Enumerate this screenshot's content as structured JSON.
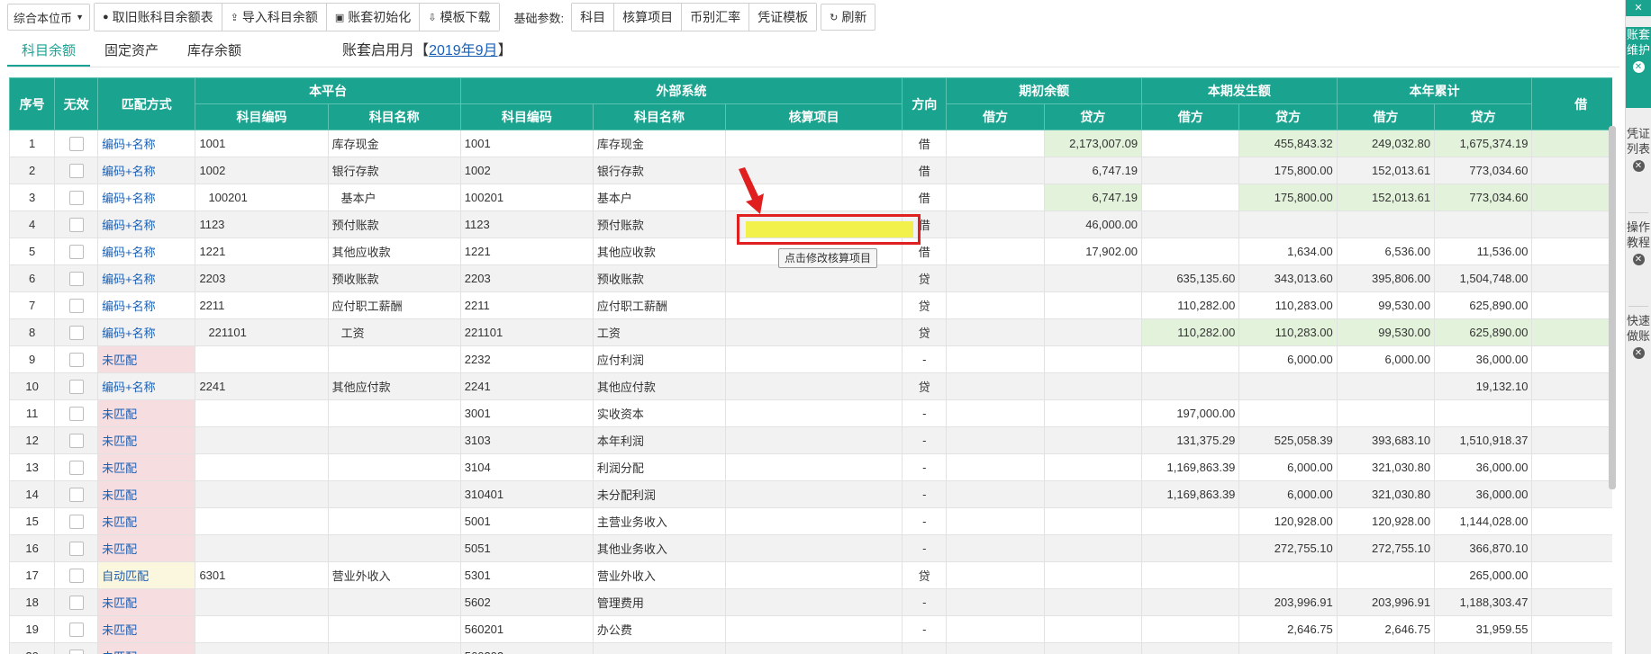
{
  "toolbar": {
    "currency_select": "综合本位币",
    "buttons": [
      "取旧账科目余额表",
      "导入科目余额",
      "账套初始化",
      "模板下载"
    ],
    "params_label": "基础参数:",
    "param_buttons": [
      "科目",
      "核算项目",
      "币别汇率",
      "凭证模板"
    ],
    "refresh": "刷新"
  },
  "tabs": [
    "科目余额",
    "固定资产",
    "库存余额"
  ],
  "enable_info": {
    "prefix": "账套启用月【",
    "link": "2019年9月",
    "suffix": "】"
  },
  "table": {
    "group_headers": {
      "seq": "序号",
      "invalid": "无效",
      "match": "匹配方式",
      "platform": "本平台",
      "external": "外部系统",
      "direction": "方向",
      "opening": "期初余额",
      "period": "本期发生额",
      "ytd": "本年累计",
      "extra": "借"
    },
    "sub_headers": {
      "code": "科目编码",
      "name": "科目名称",
      "ext_code": "科目编码",
      "ext_name": "科目名称",
      "aux": "核算项目",
      "debit": "借方",
      "credit": "贷方"
    },
    "rows": [
      {
        "seq": "1",
        "match": "编码+名称",
        "pcode": "1001",
        "pname": "库存现金",
        "ecode": "1001",
        "ename": "库存现金",
        "dir": "借",
        "od": "",
        "oc": "2,173,007.09",
        "pd": "",
        "pc": "455,843.32",
        "yd": "249,032.80",
        "yc": "1,675,374.19",
        "x": "1"
      },
      {
        "seq": "2",
        "match": "编码+名称",
        "pcode": "1002",
        "pname": "银行存款",
        "ecode": "1002",
        "ename": "银行存款",
        "dir": "借",
        "od": "",
        "oc": "6,747.19",
        "pd": "",
        "pc": "175,800.00",
        "yd": "152,013.61",
        "yc": "773,034.60",
        "x": ""
      },
      {
        "seq": "3",
        "match": "编码+名称",
        "pcode": "100201",
        "pname": "基本户",
        "ecode": "100201",
        "ename": "基本户",
        "dir": "借",
        "od": "",
        "oc": "6,747.19",
        "pd": "",
        "pc": "175,800.00",
        "yd": "152,013.61",
        "yc": "773,034.60",
        "x": ""
      },
      {
        "seq": "4",
        "match": "编码+名称",
        "pcode": "1123",
        "pname": "预付账款",
        "ecode": "1123",
        "ename": "预付账款",
        "dir": "借",
        "od": "",
        "oc": "46,000.00",
        "pd": "",
        "pc": "",
        "yd": "",
        "yc": "",
        "x": ""
      },
      {
        "seq": "5",
        "match": "编码+名称",
        "pcode": "1221",
        "pname": "其他应收款",
        "ecode": "1221",
        "ename": "其他应收款",
        "dir": "借",
        "od": "",
        "oc": "17,902.00",
        "pd": "",
        "pc": "1,634.00",
        "yd": "6,536.00",
        "yc": "11,536.00",
        "x": ""
      },
      {
        "seq": "6",
        "match": "编码+名称",
        "pcode": "2203",
        "pname": "预收账款",
        "ecode": "2203",
        "ename": "预收账款",
        "dir": "贷",
        "od": "",
        "oc": "",
        "pd": "635,135.60",
        "pc": "343,013.60",
        "yd": "395,806.00",
        "yc": "1,504,748.00",
        "x": "1"
      },
      {
        "seq": "7",
        "match": "编码+名称",
        "pcode": "2211",
        "pname": "应付职工薪酬",
        "ecode": "2211",
        "ename": "应付职工薪酬",
        "dir": "贷",
        "od": "",
        "oc": "",
        "pd": "110,282.00",
        "pc": "110,283.00",
        "yd": "99,530.00",
        "yc": "625,890.00",
        "x": ""
      },
      {
        "seq": "8",
        "match": "编码+名称",
        "pcode": "221101",
        "pname": "工资",
        "ecode": "221101",
        "ename": "工资",
        "dir": "贷",
        "od": "",
        "oc": "",
        "pd": "110,282.00",
        "pc": "110,283.00",
        "yd": "99,530.00",
        "yc": "625,890.00",
        "x": ""
      },
      {
        "seq": "9",
        "match": "未匹配",
        "pcode": "",
        "pname": "",
        "ecode": "2232",
        "ename": "应付利润",
        "dir": "-",
        "od": "",
        "oc": "",
        "pd": "",
        "pc": "6,000.00",
        "yd": "6,000.00",
        "yc": "36,000.00",
        "x": ""
      },
      {
        "seq": "10",
        "match": "编码+名称",
        "pcode": "2241",
        "pname": "其他应付款",
        "ecode": "2241",
        "ename": "其他应付款",
        "dir": "贷",
        "od": "",
        "oc": "",
        "pd": "",
        "pc": "",
        "yd": "",
        "yc": "19,132.10",
        "x": ""
      },
      {
        "seq": "11",
        "match": "未匹配",
        "pcode": "",
        "pname": "",
        "ecode": "3001",
        "ename": "实收资本",
        "dir": "-",
        "od": "",
        "oc": "",
        "pd": "197,000.00",
        "pc": "",
        "yd": "",
        "yc": "",
        "x": ""
      },
      {
        "seq": "12",
        "match": "未匹配",
        "pcode": "",
        "pname": "",
        "ecode": "3103",
        "ename": "本年利润",
        "dir": "-",
        "od": "",
        "oc": "",
        "pd": "131,375.29",
        "pc": "525,058.39",
        "yd": "393,683.10",
        "yc": "1,510,918.37",
        "x": "1"
      },
      {
        "seq": "13",
        "match": "未匹配",
        "pcode": "",
        "pname": "",
        "ecode": "3104",
        "ename": "利润分配",
        "dir": "-",
        "od": "",
        "oc": "",
        "pd": "1,169,863.39",
        "pc": "6,000.00",
        "yd": "321,030.80",
        "yc": "36,000.00",
        "x": ""
      },
      {
        "seq": "14",
        "match": "未匹配",
        "pcode": "",
        "pname": "",
        "ecode": "310401",
        "ename": "未分配利润",
        "dir": "-",
        "od": "",
        "oc": "",
        "pd": "1,169,863.39",
        "pc": "6,000.00",
        "yd": "321,030.80",
        "yc": "36,000.00",
        "x": ""
      },
      {
        "seq": "15",
        "match": "未匹配",
        "pcode": "",
        "pname": "",
        "ecode": "5001",
        "ename": "主营业务收入",
        "dir": "-",
        "od": "",
        "oc": "",
        "pd": "",
        "pc": "120,928.00",
        "yd": "120,928.00",
        "yc": "1,144,028.00",
        "x": "1"
      },
      {
        "seq": "16",
        "match": "未匹配",
        "pcode": "",
        "pname": "",
        "ecode": "5051",
        "ename": "其他业务收入",
        "dir": "-",
        "od": "",
        "oc": "",
        "pd": "",
        "pc": "272,755.10",
        "yd": "272,755.10",
        "yc": "366,870.10",
        "x": ""
      },
      {
        "seq": "17",
        "match": "自动匹配",
        "pcode": "6301",
        "pname": "营业外收入",
        "ecode": "5301",
        "ename": "营业外收入",
        "dir": "贷",
        "od": "",
        "oc": "",
        "pd": "",
        "pc": "",
        "yd": "",
        "yc": "265,000.00",
        "x": ""
      },
      {
        "seq": "18",
        "match": "未匹配",
        "pcode": "",
        "pname": "",
        "ecode": "5602",
        "ename": "管理费用",
        "dir": "-",
        "od": "",
        "oc": "",
        "pd": "",
        "pc": "203,996.91",
        "yd": "203,996.91",
        "yc": "1,188,303.47",
        "x": "1"
      },
      {
        "seq": "19",
        "match": "未匹配",
        "pcode": "",
        "pname": "",
        "ecode": "560201",
        "ename": "办公费",
        "dir": "-",
        "od": "",
        "oc": "",
        "pd": "",
        "pc": "2,646.75",
        "yd": "2,646.75",
        "yc": "31,959.55",
        "x": ""
      },
      {
        "seq": "20",
        "match": "未匹配",
        "pcode": "",
        "pname": "",
        "ecode": "560202",
        "ename": "",
        "dir": "-",
        "od": "",
        "oc": "",
        "pd": "",
        "pc": "",
        "yd": "",
        "yc": "",
        "x": ""
      }
    ]
  },
  "tooltip": "点击修改核算项目",
  "sidebar": {
    "items": [
      {
        "label": "账套维护",
        "active": true
      },
      {
        "label": "凭证列表",
        "active": false
      },
      {
        "label": "操作教程",
        "active": false
      },
      {
        "label": "快速做账",
        "active": false
      }
    ]
  },
  "colors": {
    "accent": "#1aa38f",
    "highlight": "#e3f3db",
    "unmatched": "#f6dde0",
    "callout": "#e02020",
    "marker": "#f2f04a"
  }
}
